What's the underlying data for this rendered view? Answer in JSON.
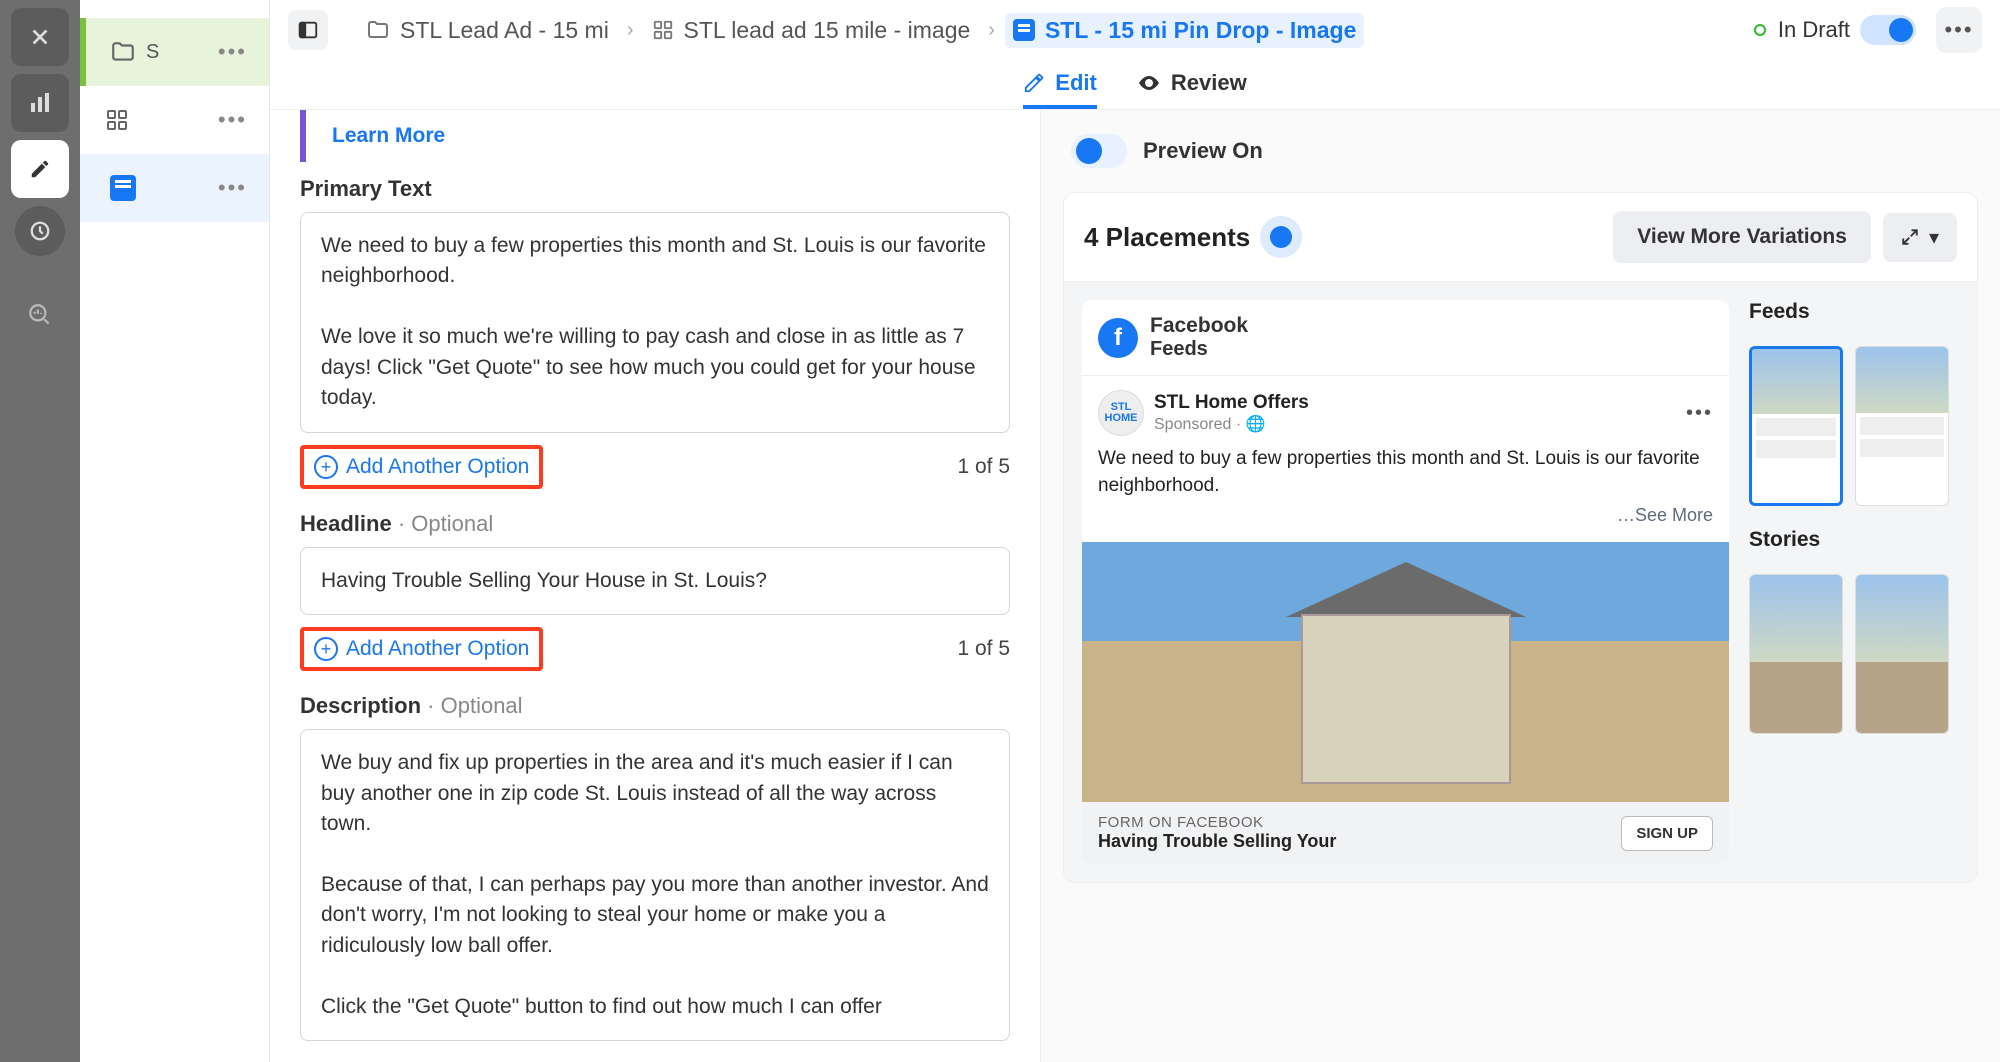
{
  "breadcrumb": {
    "campaign": "STL Lead Ad - 15 mi",
    "adset": "STL lead ad 15 mile - image",
    "ad": "STL - 15 mi Pin Drop - Image"
  },
  "status": {
    "label": "In Draft"
  },
  "tabs": {
    "edit": "Edit",
    "review": "Review"
  },
  "form": {
    "learn_more": "Learn More",
    "primary_text_label": "Primary Text",
    "primary_text_value": "We need to buy a few properties this month and St. Louis is our favorite neighborhood.\n\nWe love it so much we're willing to pay cash and close in as little as 7 days! Click \"Get Quote\" to see how much you could get for your house today.",
    "add_option": "Add Another Option",
    "primary_counter": "1 of 5",
    "headline_label": "Headline",
    "optional": "Optional",
    "headline_value": "Having Trouble Selling Your House in St. Louis?",
    "headline_counter": "1 of 5",
    "description_label": "Description",
    "description_value": "We buy and fix up properties in the area and it's much easier if I can buy another one in zip code St. Louis instead of all the way across town.\n\nBecause of that, I can perhaps pay you more than another investor. And don't worry, I'm not looking to steal your home or make you a ridiculously low ball offer.\n\nClick the \"Get Quote\" button to find out how much I can offer"
  },
  "preview": {
    "toggle_label": "Preview On",
    "placements_count": "4 Placements",
    "view_more": "View More Variations",
    "network": "Facebook",
    "surface": "Feeds",
    "page_name": "STL Home Offers",
    "sponsored": "Sponsored · 🌐",
    "post_text": "We need to buy a few properties this month and St. Louis is our favorite neighborhood.",
    "see_more": "…See More",
    "form_label": "FORM ON FACEBOOK",
    "cta_headline": "Having Trouble Selling Your",
    "cta_button": "SIGN UP",
    "thumbs": {
      "feeds": "Feeds",
      "stories": "Stories"
    }
  }
}
